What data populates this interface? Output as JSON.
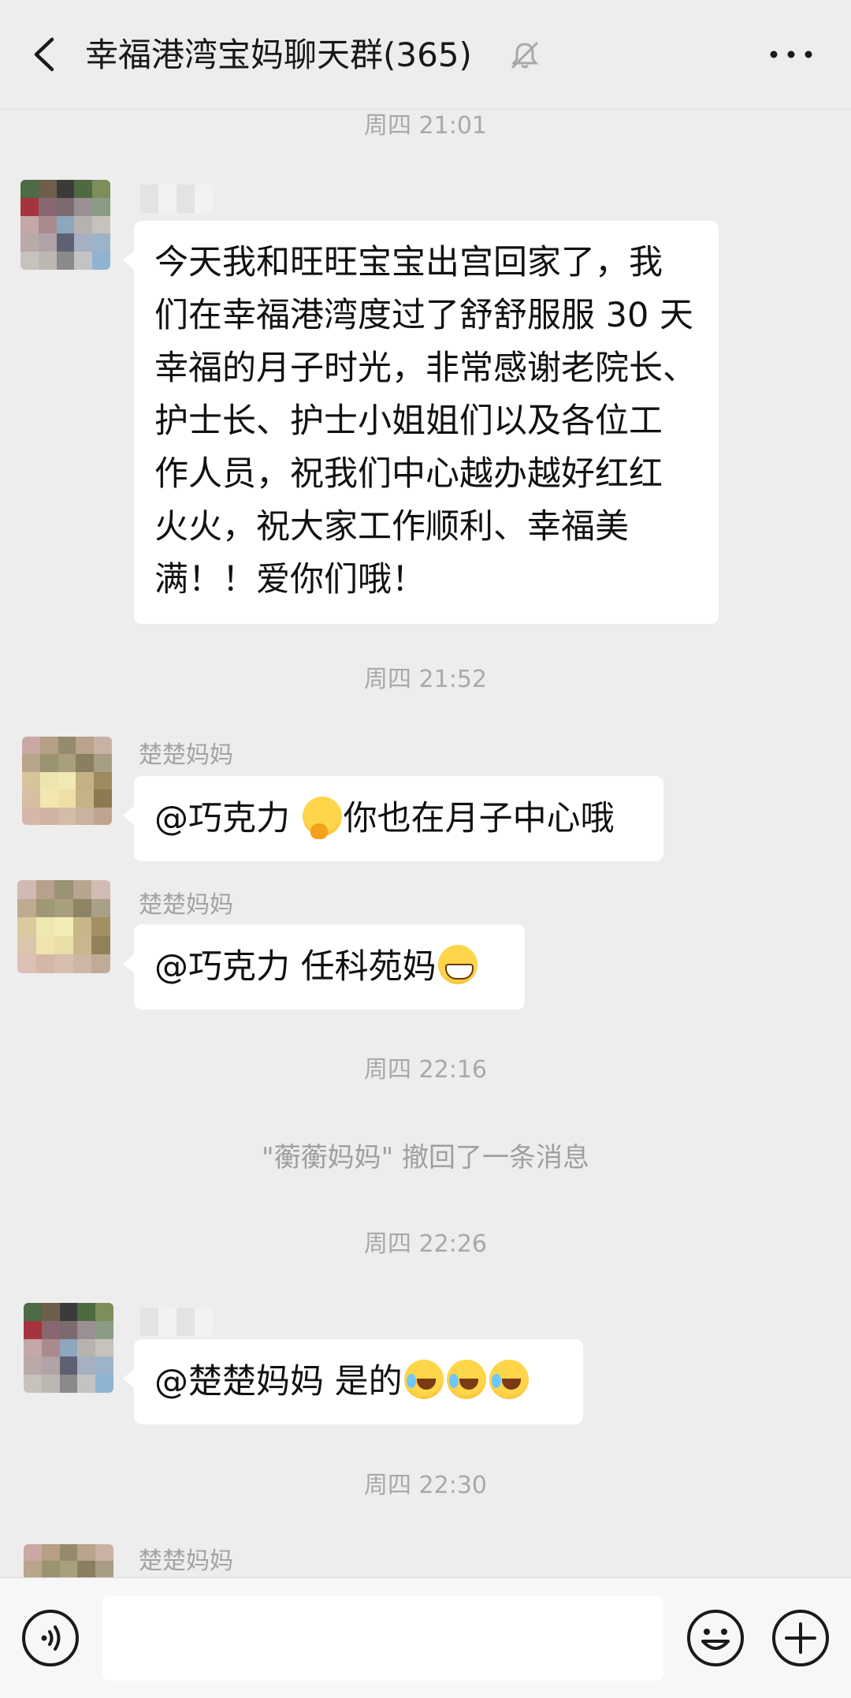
{
  "header": {
    "title": "幸福港湾宝妈聊天群(365)",
    "back_icon": "chevron-left-icon",
    "mute_icon": "bell-off-icon",
    "more_icon": "more-dots-icon"
  },
  "timestamps": [
    "周四 21:01",
    "周四 21:52",
    "周四 22:16",
    "周四 22:26",
    "周四 22:30"
  ],
  "system_message": "\"蘅蘅妈妈\" 撤回了一条消息",
  "messages": [
    {
      "sender": "",
      "lines": [
        "今天我和旺旺宝宝出宫回家了，我",
        "们在幸福港湾度过了舒舒服服 30 天",
        "幸福的月子时光，非常感谢老院长、",
        "护士长、护士小姐姐们以及各位工",
        "作人员，祝我们中心越办越好红红",
        "火火，祝大家工作顺利、幸福美",
        "满！！爱你们哦！"
      ]
    },
    {
      "sender": "楚楚妈妈",
      "prefix": "@巧克力 ",
      "emoji": "thinking-face-emoji",
      "suffix": "你也在月子中心哦"
    },
    {
      "sender": "楚楚妈妈",
      "prefix": "@巧克力  任科苑妈",
      "emoji": "grinning-face-emoji"
    },
    {
      "sender": "",
      "prefix": "@楚楚妈妈  是的",
      "emoji": "laughing-tears-emoji",
      "emoji_count": 3
    },
    {
      "sender": "楚楚妈妈"
    }
  ],
  "input": {
    "value": "",
    "placeholder": ""
  },
  "bottom_icons": [
    "voice-icon",
    "emoji-icon",
    "plus-icon"
  ],
  "colors": {
    "background": "#ededed",
    "bubble": "#ffffff",
    "timestamp": "#a9a9a9"
  }
}
